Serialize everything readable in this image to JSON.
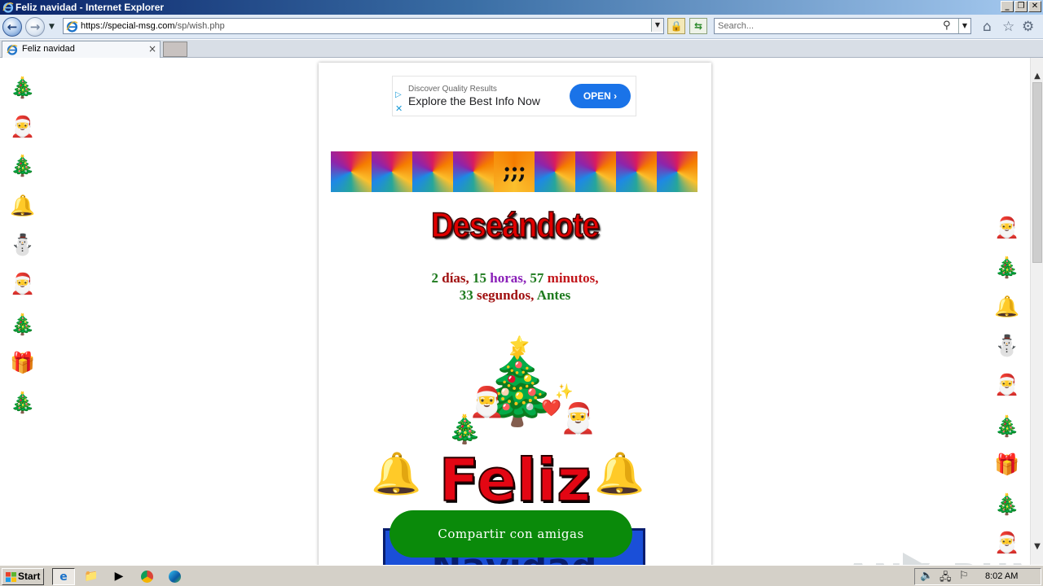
{
  "window": {
    "title": "Feliz navidad - Internet Explorer",
    "controls": {
      "minimize": "_",
      "maximize": "❐",
      "close": "✕"
    }
  },
  "navbar": {
    "url_prefix": "https://special-msg.com",
    "url_path": "/sp/wish.php",
    "search_placeholder": "Search...",
    "icons": [
      "back-icon",
      "forward-icon",
      "lock-icon",
      "refresh-icon",
      "search-icon",
      "home-icon",
      "favorites-icon",
      "settings-icon"
    ]
  },
  "tab": {
    "title": "Feliz navidad",
    "close": "×"
  },
  "ad": {
    "subtitle": "Discover Quality Results",
    "headline": "Explore the Best Info Now",
    "button": "OPEN ›",
    "play": "▷",
    "close": "✕"
  },
  "strip": {
    "dots_label": ";;;"
  },
  "greeting": {
    "heading": "Deseándote",
    "countdown": {
      "days_num": "2",
      "days_word": "días,",
      "hours_num": "15",
      "hours_word": "horas,",
      "minutes_num": "57",
      "minutes_word": "minutos,",
      "seconds_num": "33",
      "seconds_word": "segundos,",
      "suffix": "Antes"
    },
    "feliz": "Feliz",
    "navidad": "Navidad",
    "share_button": "Compartir con amigas"
  },
  "side_emojis": {
    "left": [
      "🎄",
      "🎅",
      "🎄",
      "🔔",
      "⛄",
      "🎅",
      "🎄",
      "🎁",
      "🎄"
    ],
    "right": [
      "🎅",
      "🎄",
      "🔔",
      "⛄",
      "🎅",
      "🎄",
      "🎁",
      "🎄",
      "🎅"
    ]
  },
  "taskbar": {
    "start": "Start",
    "clock": "8:02 AM"
  },
  "watermark": {
    "left": "ANY",
    "right": "RUN"
  }
}
